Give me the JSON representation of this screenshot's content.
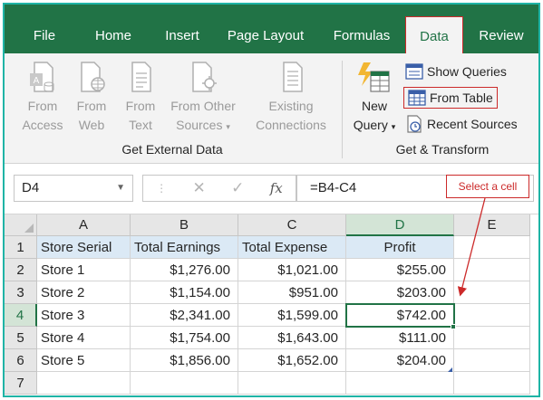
{
  "ribbon_tabs": [
    "File",
    "Home",
    "Insert",
    "Page Layout",
    "Formulas",
    "Data",
    "Review"
  ],
  "active_tab": "Data",
  "get_external_data": {
    "buttons": [
      {
        "line1": "From",
        "line2": "Access",
        "icon": "access-db-icon"
      },
      {
        "line1": "From",
        "line2": "Web",
        "icon": "web-page-icon"
      },
      {
        "line1": "From",
        "line2": "Text",
        "icon": "text-file-icon"
      },
      {
        "line1": "From Other",
        "line2": "Sources",
        "icon": "other-sources-icon"
      },
      {
        "line1": "Existing",
        "line2": "Connections",
        "icon": "connections-icon"
      }
    ],
    "label": "Get External Data"
  },
  "get_transform": {
    "new_query_line1": "New",
    "new_query_line2": "Query",
    "show_queries": "Show Queries",
    "from_table": "From Table",
    "recent_sources": "Recent Sources",
    "label": "Get & Transform"
  },
  "formula_bar": {
    "name_box": "D4",
    "formula": "=B4-C4",
    "fx": "fx"
  },
  "callout": "Select a cell",
  "columns": [
    "A",
    "B",
    "C",
    "D",
    "E"
  ],
  "selected_column": "D",
  "rows": [
    "1",
    "2",
    "3",
    "4",
    "5",
    "6",
    "7"
  ],
  "selected_row": "4",
  "table": {
    "headers": [
      "Store Serial",
      "Total Earnings",
      "Total Expense",
      "Profit"
    ],
    "data": [
      [
        "Store 1",
        "$1,276.00",
        "$1,021.00",
        "$255.00"
      ],
      [
        "Store 2",
        "$1,154.00",
        "$951.00",
        "$203.00"
      ],
      [
        "Store 3",
        "$2,341.00",
        "$1,599.00",
        "$742.00"
      ],
      [
        "Store 4",
        "$1,754.00",
        "$1,643.00",
        "$111.00"
      ],
      [
        "Store 5",
        "$1,856.00",
        "$1,652.00",
        "$204.00"
      ]
    ]
  },
  "colors": {
    "excel_green": "#217346",
    "highlight_red": "#cc2a2a",
    "header_fill": "#dbe9f5"
  }
}
